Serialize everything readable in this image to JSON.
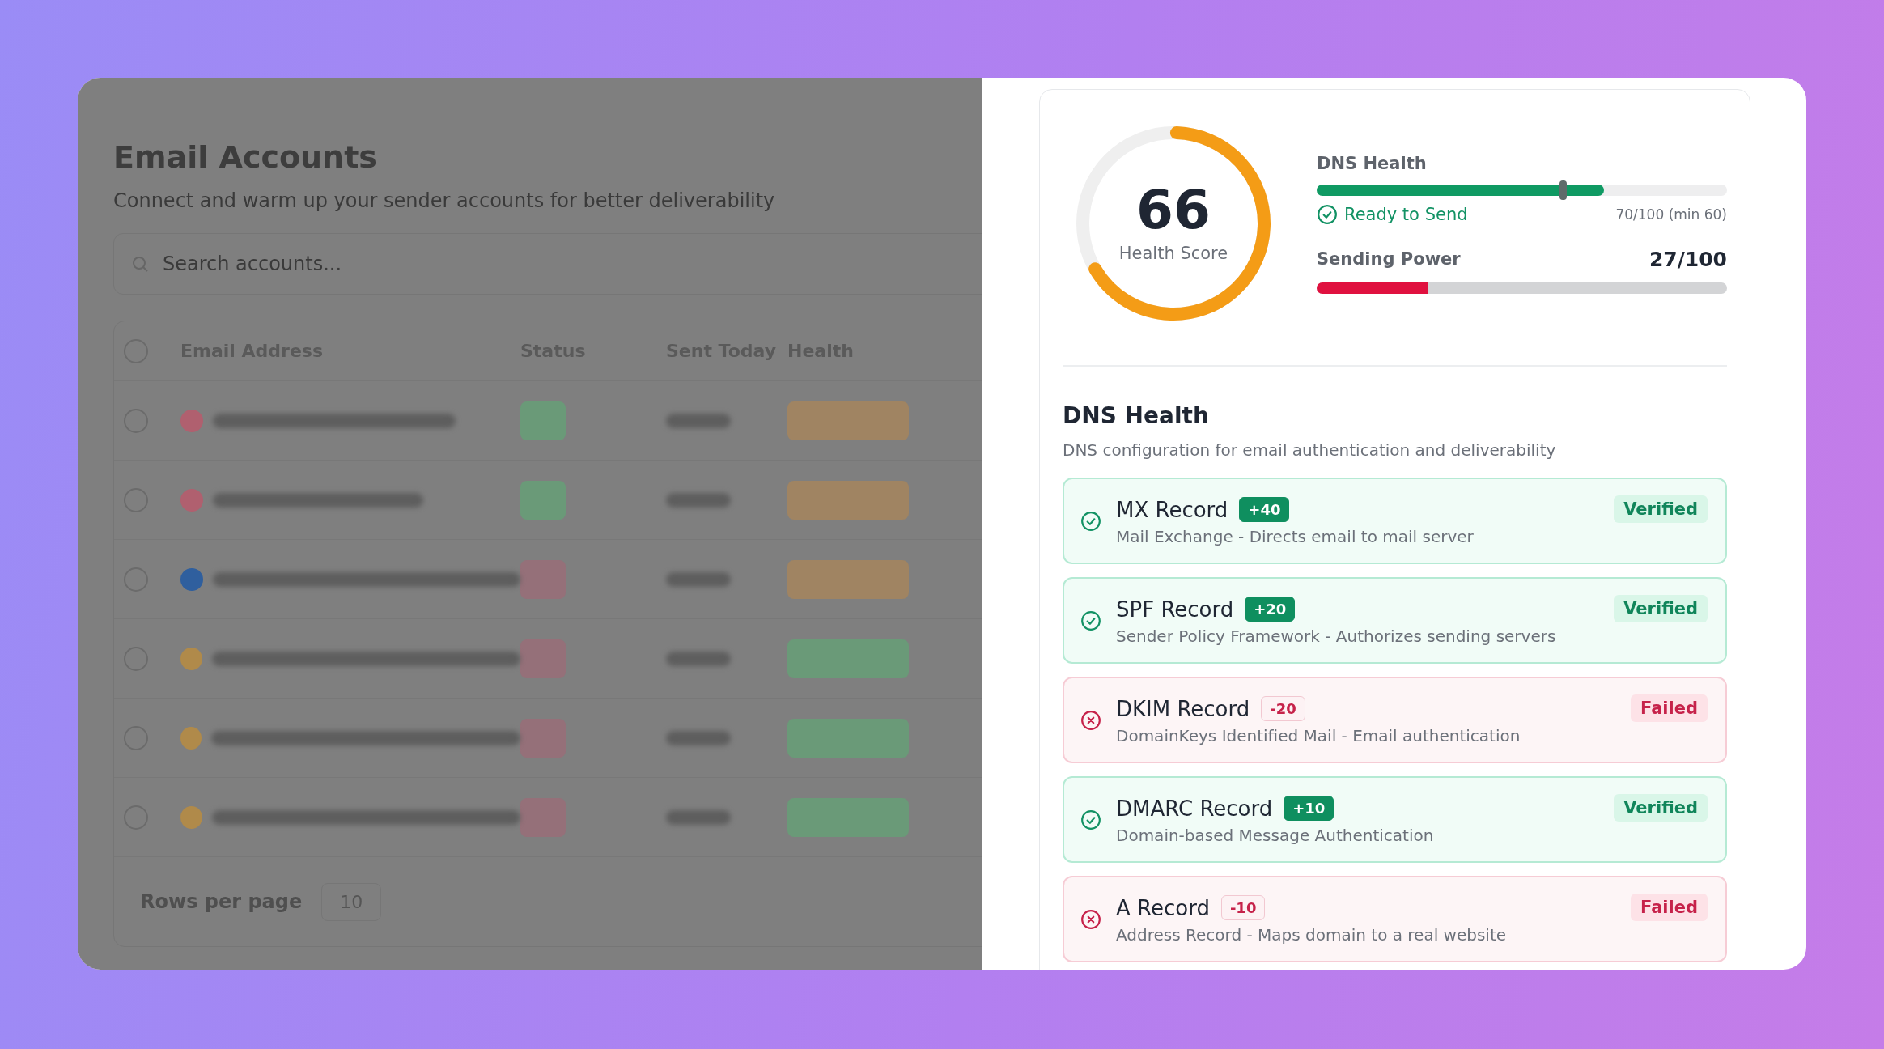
{
  "background_page": {
    "title": "Email Accounts",
    "subtitle": "Connect and warm up your sender accounts for better deliverability",
    "search": {
      "placeholder": "Search accounts..."
    },
    "table": {
      "select_all": {
        "checked": false
      },
      "columns": [
        "Email Address",
        "Status",
        "Sent Today",
        "Health"
      ],
      "rows": [
        {
          "checked": false,
          "provider": {
            "color": "#b0606f"
          },
          "status": {
            "color": "#6a9a78"
          },
          "health": {
            "color": "#a08462"
          }
        },
        {
          "checked": false,
          "provider": {
            "color": "#b0606f"
          },
          "status": {
            "color": "#6a9a78"
          },
          "health": {
            "color": "#a08462"
          }
        },
        {
          "checked": false,
          "provider": {
            "color": "#2f5f9e"
          },
          "status": {
            "color": "#957079"
          },
          "health": {
            "color": "#a08462"
          }
        },
        {
          "checked": false,
          "provider": {
            "color": "#b08a4a"
          },
          "status": {
            "color": "#957079"
          },
          "health": {
            "color": "#6a9a78"
          }
        },
        {
          "checked": false,
          "provider": {
            "color": "#b08a4a"
          },
          "status": {
            "color": "#957079"
          },
          "health": {
            "color": "#6a9a78"
          }
        },
        {
          "checked": false,
          "provider": {
            "color": "#b08a4a"
          },
          "status": {
            "color": "#957079"
          },
          "health": {
            "color": "#6a9a78"
          }
        }
      ]
    },
    "rows_per_page": {
      "label": "Rows per page",
      "value": "10"
    }
  },
  "health_score": {
    "value": "66",
    "label": "Health Score",
    "level": 0.66
  },
  "dns_health_meter": {
    "label": "DNS Health",
    "level": 0.7,
    "minimum_marker": {
      "level": 0.6
    },
    "status": "Ready to Send",
    "reading": "70/100 (min 60)"
  },
  "sending_power": {
    "label": "Sending Power",
    "reading": "27/100",
    "level": 0.27
  },
  "dns_section": {
    "title": "DNS Health",
    "subtitle": "DNS configuration for email authentication and deliverability",
    "records": [
      {
        "kind": "verified",
        "name": "MX Record",
        "points": "+40",
        "description": "Mail Exchange - Directs email to mail server",
        "status": "Verified"
      },
      {
        "kind": "verified",
        "name": "SPF Record",
        "points": "+20",
        "description": "Sender Policy Framework - Authorizes sending servers",
        "status": "Verified"
      },
      {
        "kind": "failed",
        "name": "DKIM Record",
        "points": "-20",
        "description": "DomainKeys Identified Mail - Email authentication",
        "status": "Failed"
      },
      {
        "kind": "verified",
        "name": "DMARC Record",
        "points": "+10",
        "description": "Domain-based Message Authentication",
        "status": "Verified"
      },
      {
        "kind": "failed",
        "name": "A Record",
        "points": "-10",
        "description": "Address Record - Maps domain to a real website",
        "status": "Failed"
      }
    ]
  }
}
